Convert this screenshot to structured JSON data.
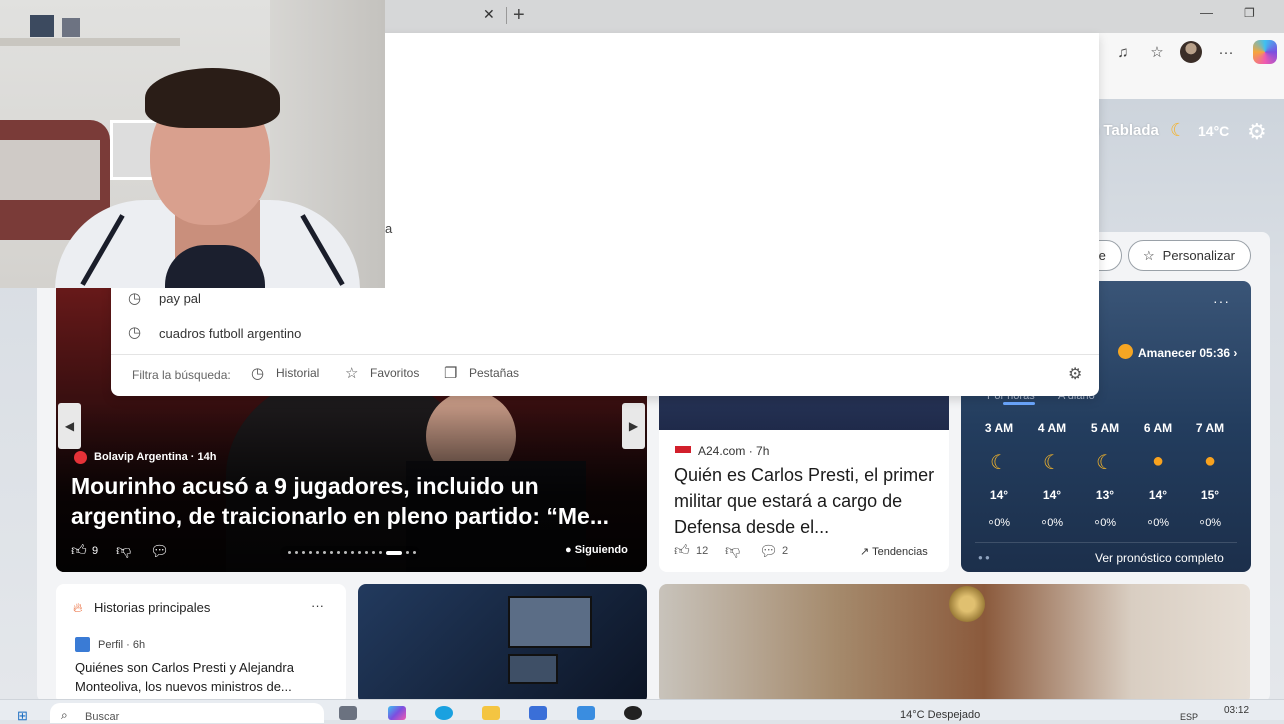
{
  "browser": {
    "tab_close": "✕",
    "new_tab": "+",
    "minimize": "—",
    "restore": "❐",
    "toolbar_icons": [
      "read-aloud-icon",
      "favorites-icon",
      "profile-avatar",
      "more-icon",
      "copilot-icon"
    ]
  },
  "ntp": {
    "location": "n Tablada",
    "temperature": "14°C",
    "buttons": {
      "partial": "te",
      "customize": "Personalizar"
    }
  },
  "search_dropdown": {
    "cutoff_text": "a",
    "suggestions": [
      "pay pal",
      "cuadros futboll argentino"
    ],
    "filter_label": "Filtra la búsqueda:",
    "filters": [
      "Historial",
      "Favoritos",
      "Pestañas"
    ]
  },
  "hero": {
    "source": "Bolavip Argentina · 14h",
    "title": "Mourinho acusó a 9 jugadores, incluido un argentino, de traicionarlo en pleno partido: “Me...",
    "likes": "9",
    "following": "Siguiendo"
  },
  "news2": {
    "source": "A24.com · 7h",
    "title": "Quién es Carlos Presti, el primer militar que estará a cargo de Defensa desde el...",
    "likes": "12",
    "comments": "2",
    "trends": "Tendencias"
  },
  "weather": {
    "menu": "···",
    "sunrise": "Amanecer 05:36",
    "tabs": [
      "Por horas",
      "A diario"
    ],
    "hours": [
      {
        "time": "3 AM",
        "icon": "moon-icon",
        "temp": "14°",
        "precip": "0%"
      },
      {
        "time": "4 AM",
        "icon": "moon-icon",
        "temp": "14°",
        "precip": "0%"
      },
      {
        "time": "5 AM",
        "icon": "moon-icon",
        "temp": "13°",
        "precip": "0%"
      },
      {
        "time": "6 AM",
        "icon": "sun-icon",
        "temp": "14°",
        "precip": "0%"
      },
      {
        "time": "7 AM",
        "icon": "sun-icon",
        "temp": "15°",
        "precip": "0%"
      }
    ],
    "full_forecast": "Ver pronóstico completo"
  },
  "top_stories": {
    "title": "Historias principales",
    "more": "···",
    "source": "Perfil · 6h",
    "headline": "Quiénes son Carlos Presti y Alejandra Monteoliva, los nuevos ministros de..."
  },
  "taskbar": {
    "search": "Buscar",
    "weather": "14°C  Despejado",
    "lang": "ESP",
    "time": "03:12"
  },
  "colors": {
    "weather_card": "#233d5e",
    "accent_orange": "#f6a623",
    "hero_bg": "#3a0f10"
  }
}
